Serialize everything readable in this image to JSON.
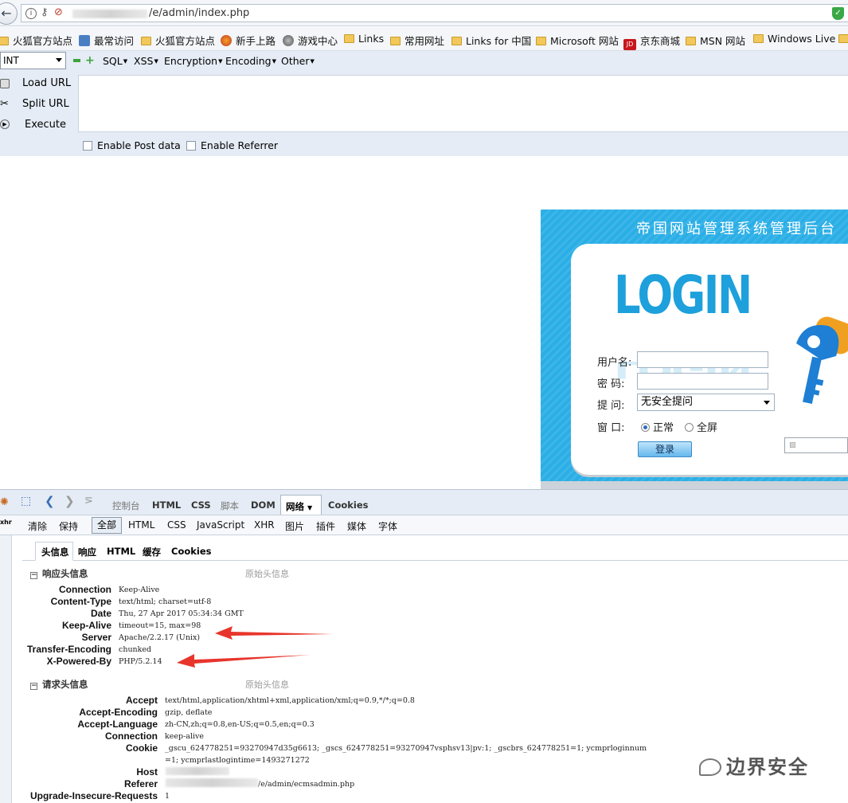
{
  "browser": {
    "url_suffix": "/e/admin/index.php",
    "bookmarks": [
      "火狐官方站点",
      "最常访问",
      "火狐官方站点",
      "新手上路",
      "游戏中心",
      "Links",
      "常用网址",
      "Links for 中国",
      "Microsoft 网站",
      "京东商城",
      "MSN 网站",
      "Windows Live"
    ]
  },
  "hackbar": {
    "select_value": "INT",
    "menus": [
      "SQL",
      "XSS",
      "Encryption",
      "Encoding",
      "Other"
    ],
    "load_url": "Load URL",
    "split_url": "Split URL",
    "execute": "Execute",
    "enable_post": "Enable Post data",
    "enable_referrer": "Enable Referrer"
  },
  "login": {
    "title": "帝国网站管理系统管理后台",
    "logo_word": "LOGIN",
    "username_label": "用户名:",
    "password_label": "密  码:",
    "question_label": "提  问:",
    "question_value": "无安全提问",
    "window_label": "窗  口:",
    "window_normal": "正常",
    "window_full": "全屏",
    "submit": "登录"
  },
  "firebug": {
    "tabs": [
      "控制台",
      "HTML",
      "CSS",
      "脚本",
      "DOM",
      "网络",
      "Cookies"
    ],
    "active_tab": "网络",
    "toolbar": [
      "清除",
      "保持",
      "全部",
      "HTML",
      "CSS",
      "JavaScript",
      "XHR",
      "图片",
      "插件",
      "媒体",
      "字体"
    ],
    "subtabs": [
      "头信息",
      "响应",
      "HTML",
      "缓存",
      "Cookies"
    ],
    "response_section": "响应头信息",
    "request_section": "请求头信息",
    "raw_label": "原始头信息",
    "response_headers": [
      {
        "name": "Connection",
        "value": "Keep-Alive"
      },
      {
        "name": "Content-Type",
        "value": "text/html; charset=utf-8"
      },
      {
        "name": "Date",
        "value": "Thu, 27 Apr 2017 05:34:34 GMT"
      },
      {
        "name": "Keep-Alive",
        "value": "timeout=15, max=98"
      },
      {
        "name": "Server",
        "value": "Apache/2.2.17 (Unix)"
      },
      {
        "name": "Transfer-Encoding",
        "value": "chunked"
      },
      {
        "name": "X-Powered-By",
        "value": "PHP/5.2.14"
      }
    ],
    "request_headers": [
      {
        "name": "Accept",
        "value": "text/html,application/xhtml+xml,application/xml;q=0.9,*/*;q=0.8"
      },
      {
        "name": "Accept-Encoding",
        "value": "gzip, deflate"
      },
      {
        "name": "Accept-Language",
        "value": "zh-CN,zh;q=0.8,en-US;q=0.5,en;q=0.3"
      },
      {
        "name": "Connection",
        "value": "keep-alive"
      },
      {
        "name": "Cookie",
        "value": "_gscu_624778251=93270947d35g6613; _gscs_624778251=93270947vsphsv13|pv:1; _gscbrs_624778251=1; ycmprloginnum"
      },
      {
        "name": "",
        "value": "=1; ycmprlastlogintime=1493271272"
      },
      {
        "name": "Host",
        "value": ""
      },
      {
        "name": "Referer",
        "value": "/e/admin/ecmsadmin.php"
      },
      {
        "name": "Upgrade-Insecure-Requests",
        "value": "1"
      }
    ]
  },
  "watermark": "边界安全"
}
